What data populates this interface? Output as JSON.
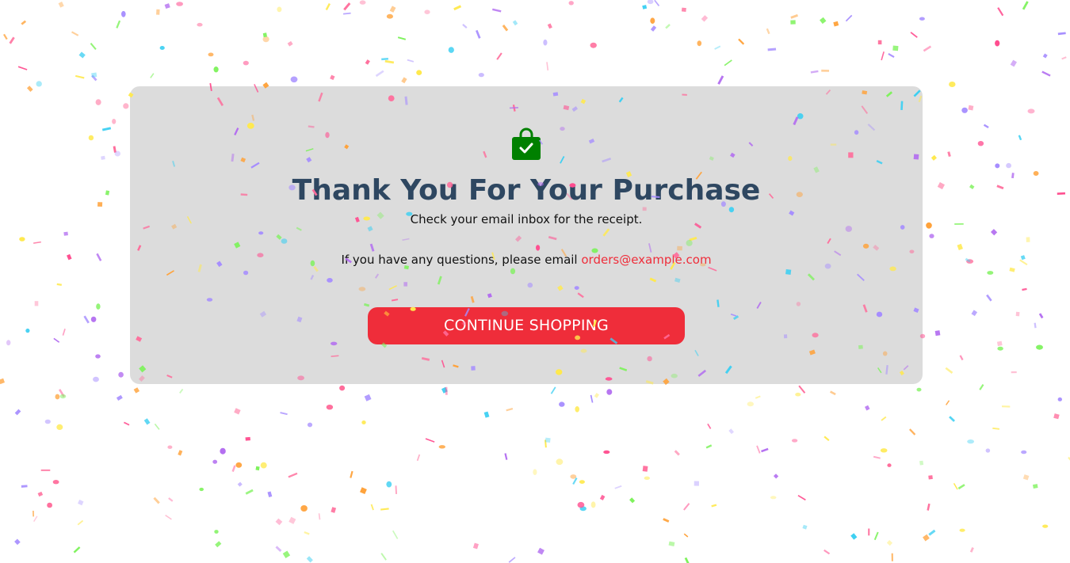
{
  "confirmation": {
    "icon": "shopping-bag-check-icon",
    "title": "Thank You For Your Purchase",
    "subtitle": "Check your email inbox for the receipt.",
    "questions_text": "If you have any questions, please email ",
    "email": "orders@example.com",
    "button_label": "CONTINUE SHOPPING"
  },
  "colors": {
    "card_background": "#dcdcdc",
    "title": "#2e4761",
    "accent": "#ef2d3a",
    "icon": "#008000",
    "confetti": [
      "#ff6b9a",
      "#7cf25a",
      "#ffe94d",
      "#b26cf0",
      "#3ccff2",
      "#ffa23a",
      "#ff4d8f",
      "#a58cff"
    ]
  }
}
